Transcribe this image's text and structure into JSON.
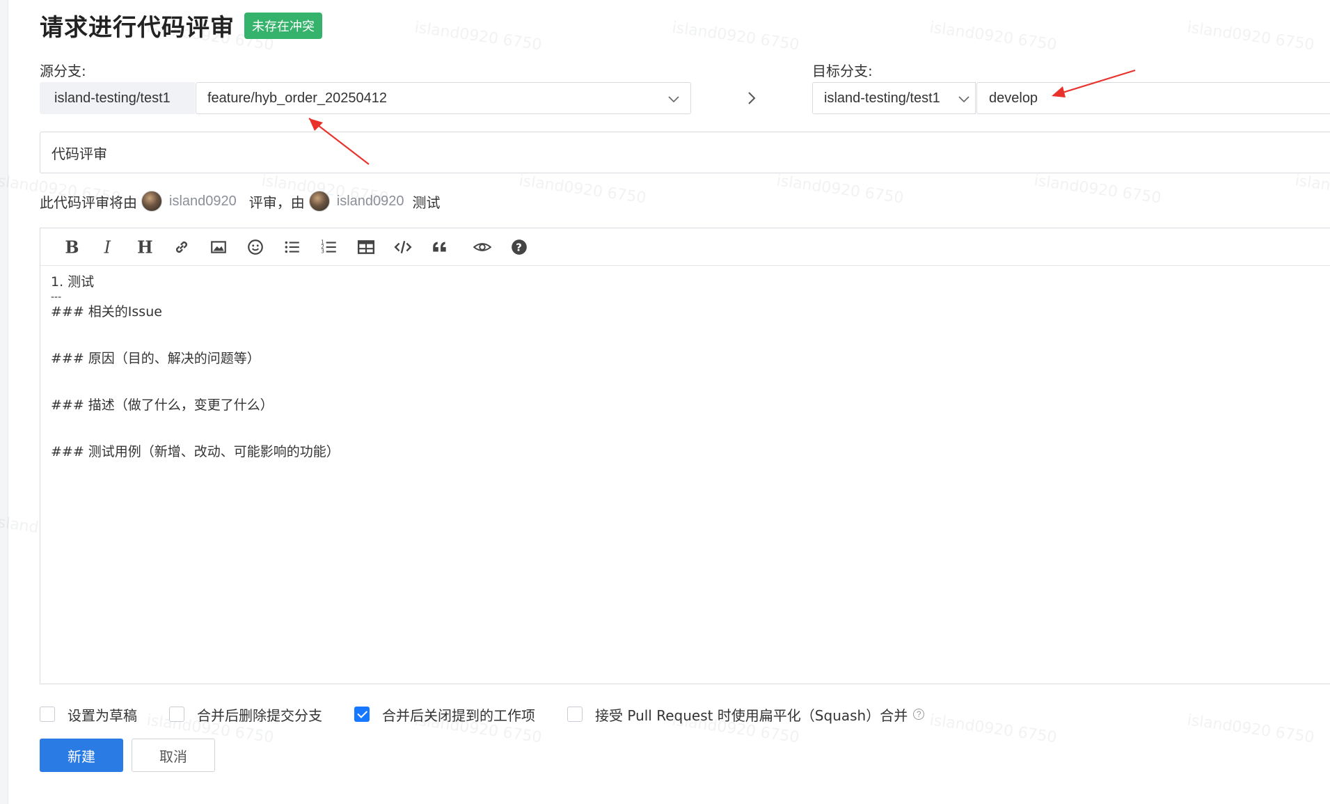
{
  "header": {
    "title": "请求进行代码评审",
    "badge": "未存在冲突"
  },
  "source": {
    "label": "源分支:",
    "repo": "island-testing/test1",
    "branch": "feature/hyb_order_20250412"
  },
  "target": {
    "label": "目标分支:",
    "repo": "island-testing/test1",
    "branch": "develop"
  },
  "title_input": {
    "value": "代码评审"
  },
  "reviewers": {
    "prefix": "此代码评审将由",
    "reviewer": "island0920",
    "middle": "评审，由",
    "tester": "island0920",
    "suffix": "测试"
  },
  "toolbar": {
    "icons": [
      "bold-icon",
      "italic-icon",
      "heading-icon",
      "link-icon",
      "image-icon",
      "emoji-icon",
      "bullet-list-icon",
      "numbered-list-icon",
      "table-icon",
      "code-icon",
      "quote-icon",
      "preview-icon",
      "help-icon"
    ]
  },
  "editor": {
    "lines": [
      "1. 测试",
      "---",
      "### 相关的Issue",
      "",
      "",
      "### 原因（目的、解决的问题等）",
      "",
      "",
      "### 描述（做了什么，变更了什么）",
      "",
      "",
      "### 测试用例（新增、改动、可能影响的功能）"
    ]
  },
  "options": {
    "draft": {
      "label": "设置为草稿",
      "checked": false
    },
    "delete_branch": {
      "label": "合并后删除提交分支",
      "checked": false
    },
    "close_items": {
      "label": "合并后关闭提到的工作项",
      "checked": true
    },
    "squash": {
      "label": "接受 Pull Request 时使用扁平化（Squash）合并",
      "checked": false
    }
  },
  "actions": {
    "create": "新建",
    "cancel": "取消"
  },
  "watermark": "island0920 6750",
  "colors": {
    "badge": "#35b26b",
    "primary": "#2b7be4",
    "annotation": "#e8322b"
  }
}
